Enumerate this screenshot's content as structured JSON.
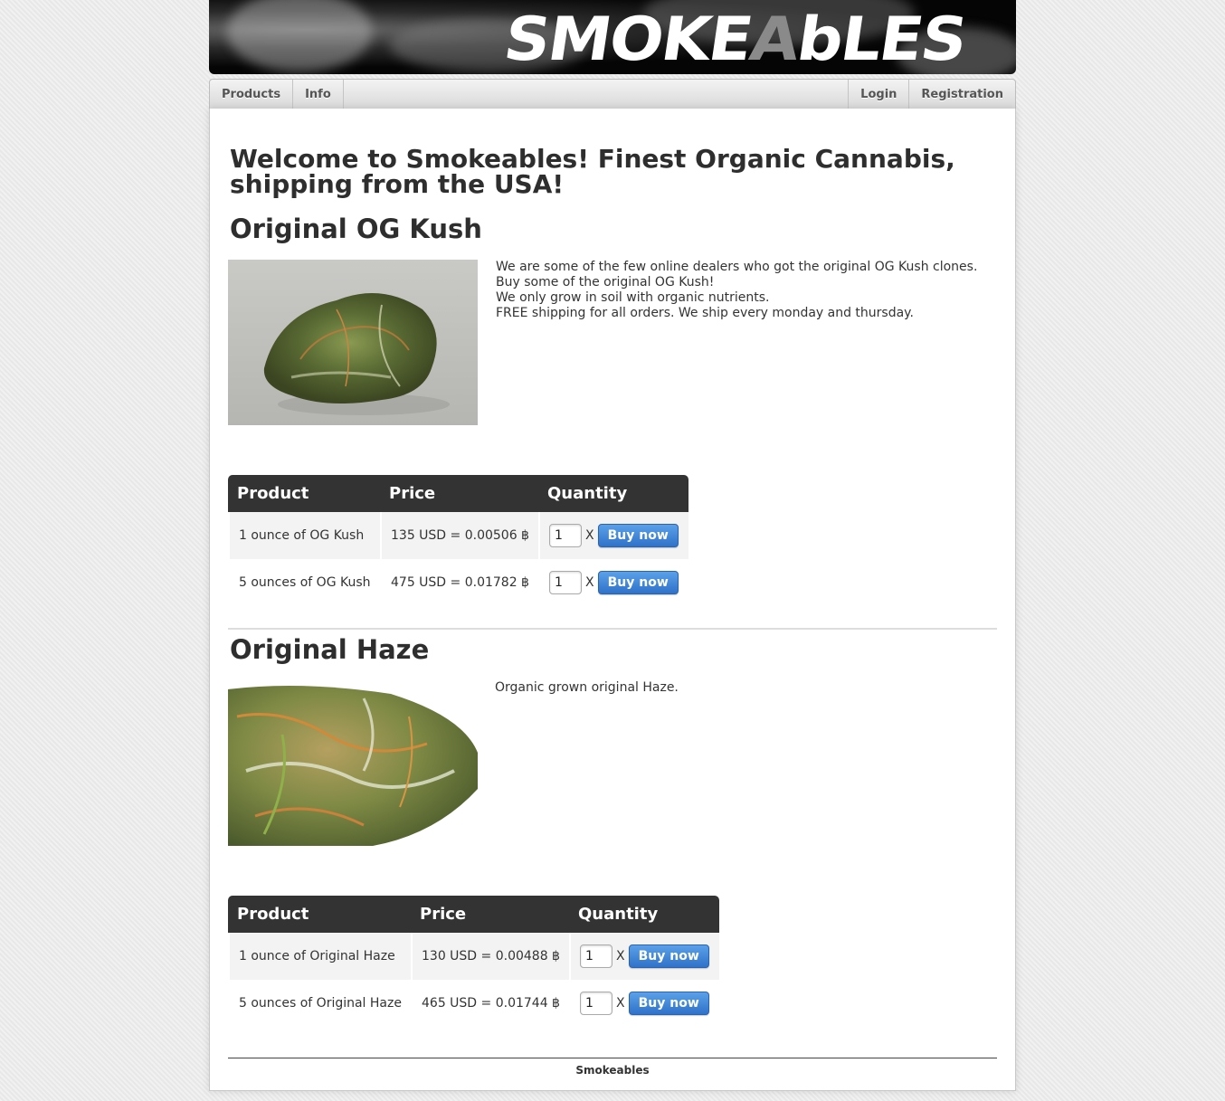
{
  "site": {
    "logo_main": "SMOKE",
    "logo_a": "A",
    "logo_end": "bLES"
  },
  "nav": {
    "left": [
      "Products",
      "Info"
    ],
    "right": [
      "Login",
      "Registration"
    ]
  },
  "welcome": "Welcome to Smokeables! Finest Organic Cannabis, shipping from the USA!",
  "table_headers": {
    "product": "Product",
    "price": "Price",
    "quantity": "Quantity"
  },
  "buy_label": "Buy now",
  "times": "X",
  "products": [
    {
      "title": "Original OG Kush",
      "description": [
        "We are some of the few online dealers who got the original OG Kush clones.",
        "Buy some of the original OG Kush!",
        "We only grow in soil with organic nutrients.",
        "FREE shipping for all orders. We ship every monday and thursday."
      ],
      "rows": [
        {
          "product": "1 ounce of OG Kush",
          "price": "135 USD = 0.00506 ฿",
          "qty": "1"
        },
        {
          "product": "5 ounces of OG Kush",
          "price": "475 USD = 0.01782 ฿",
          "qty": "1"
        }
      ]
    },
    {
      "title": "Original Haze",
      "description": [
        "Organic grown original Haze."
      ],
      "rows": [
        {
          "product": "1 ounce of Original Haze",
          "price": "130 USD = 0.00488 ฿",
          "qty": "1"
        },
        {
          "product": "5 ounces of Original Haze",
          "price": "465 USD = 0.01744 ฿",
          "qty": "1"
        }
      ]
    }
  ],
  "footer": "Smokeables"
}
